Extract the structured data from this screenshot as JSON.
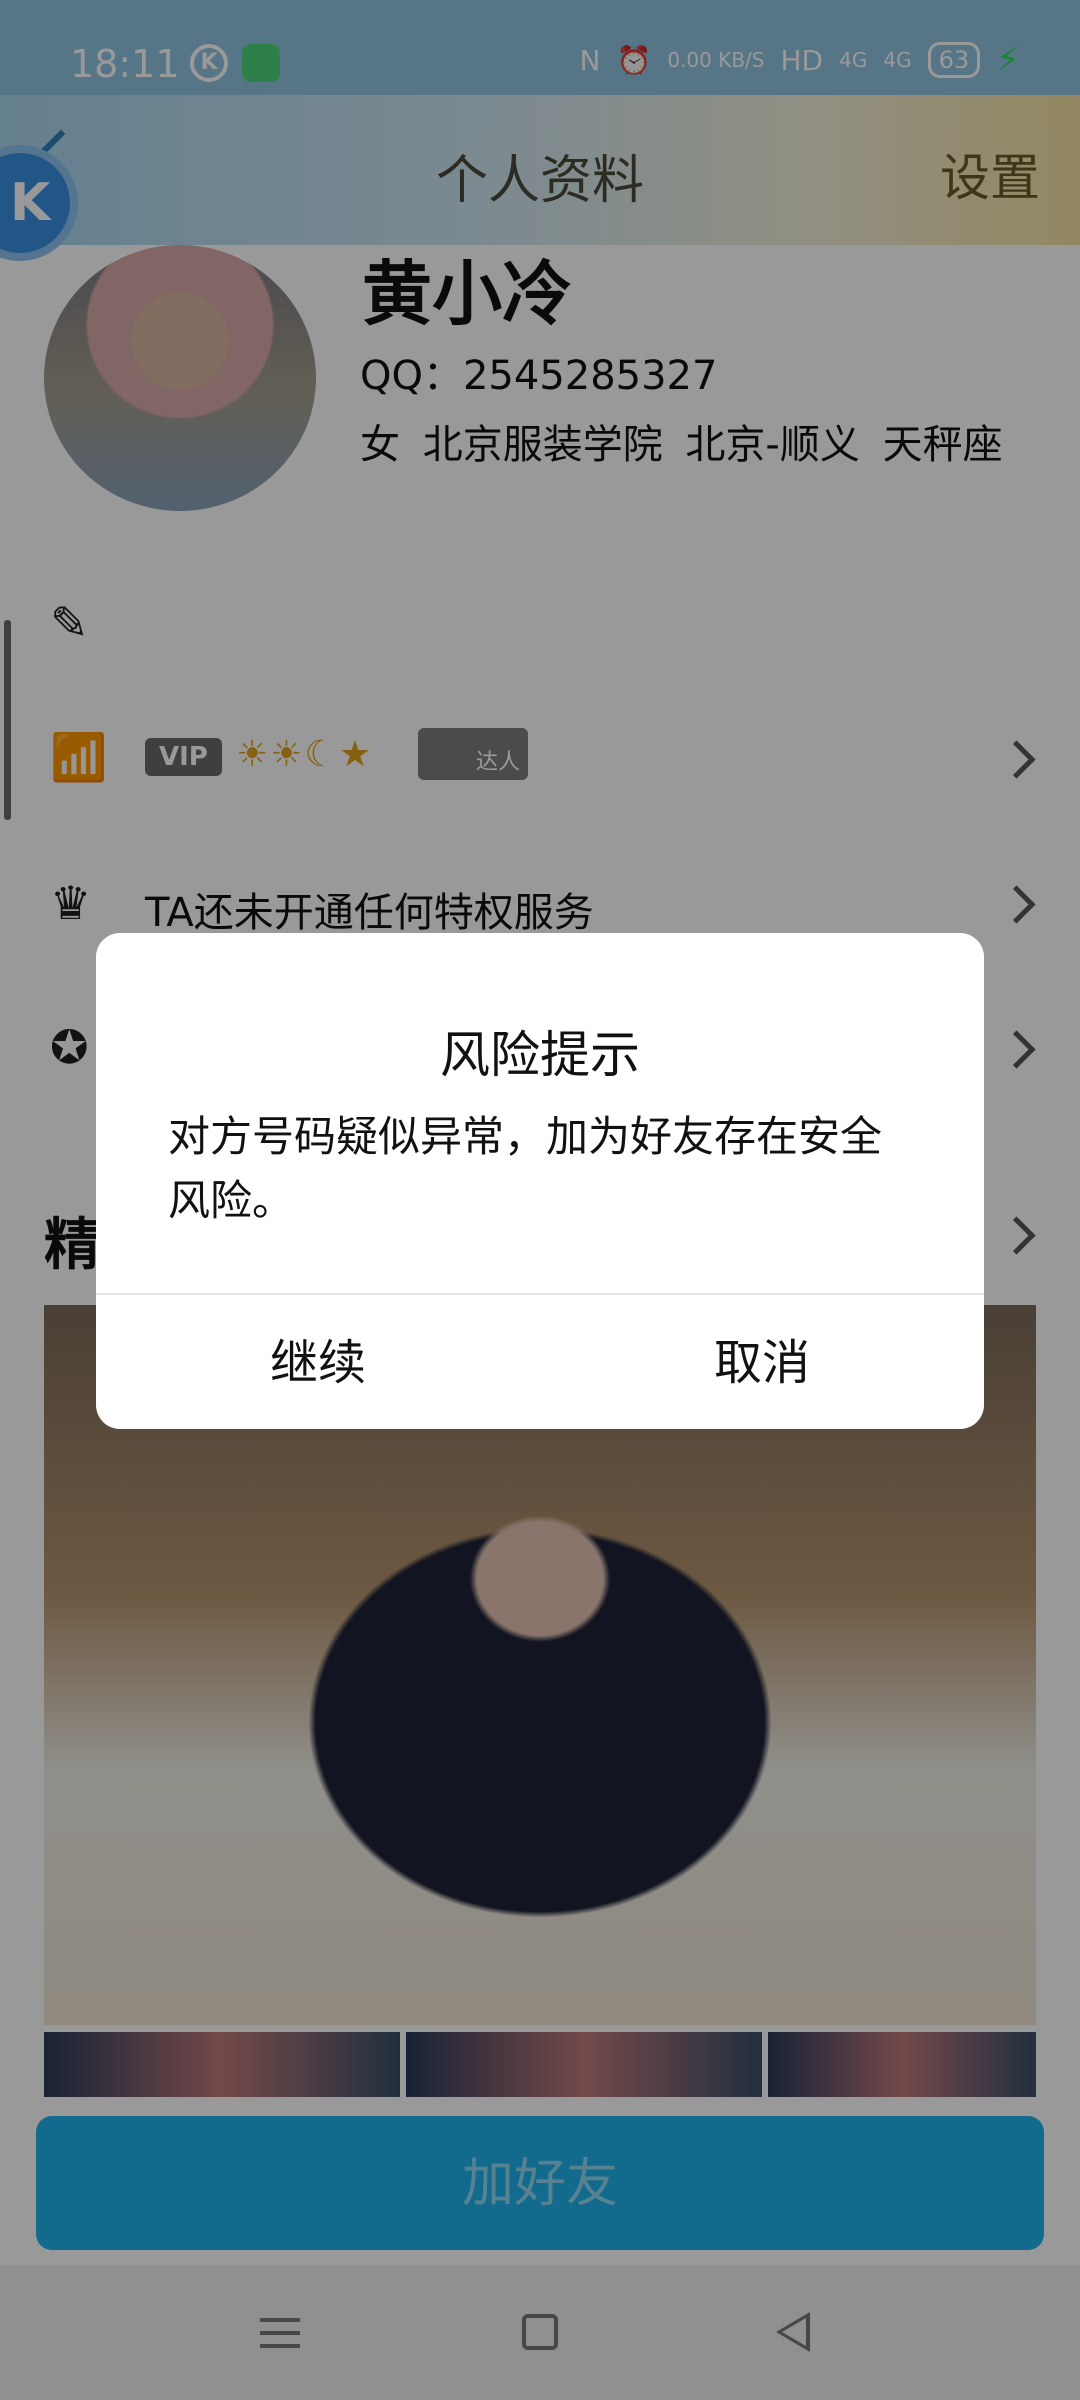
{
  "status_bar": {
    "time": "18:11",
    "badge": "K",
    "network": "0.00 KB/S",
    "hd": "HD",
    "signal1": "4G",
    "signal2": "4G",
    "battery": "63"
  },
  "header": {
    "title": "个人资料",
    "settings": "设置"
  },
  "profile": {
    "name": "黄小冷",
    "qq": "QQ：2545285327",
    "meta": "女  北京服装学院  北京-顺义  天秤座"
  },
  "rows": {
    "vip_label": "VIP",
    "daren_label": "达人",
    "privilege_text": "TA还未开通任何特权服务",
    "section_title": "精"
  },
  "bottom": {
    "add_friend": "加好友"
  },
  "dialog": {
    "title": "风险提示",
    "body": "对方号码疑似异常，加为好友存在安全风险。",
    "continue": "继续",
    "cancel": "取消"
  }
}
